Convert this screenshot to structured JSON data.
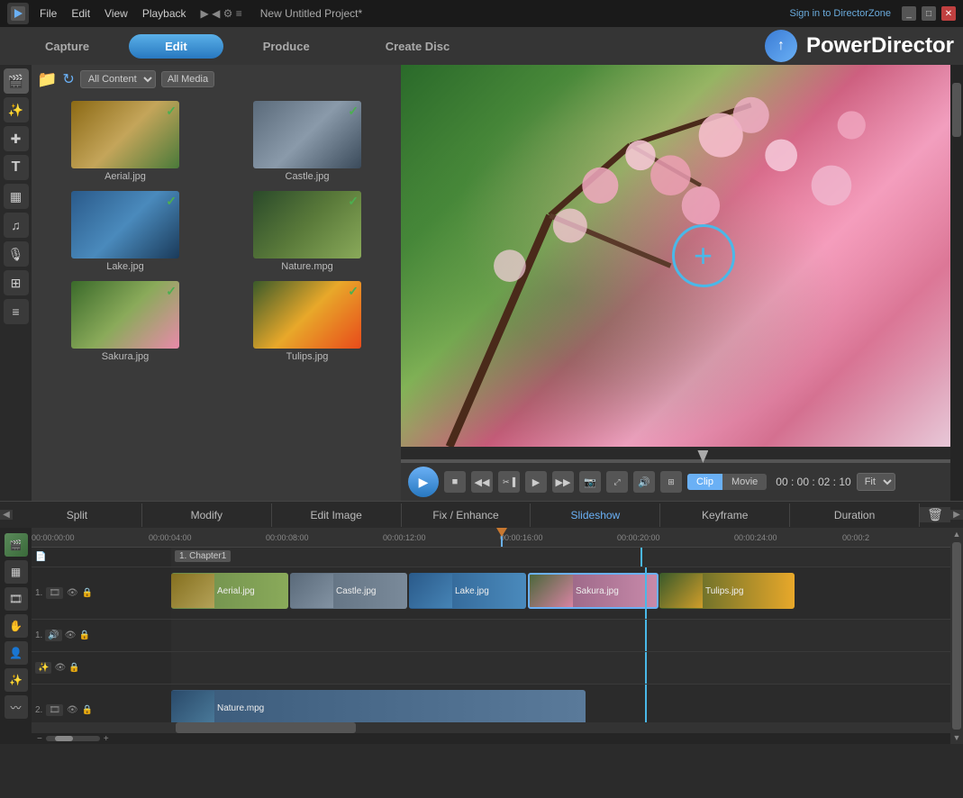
{
  "titlebar": {
    "menu": [
      "File",
      "Edit",
      "View",
      "Playback"
    ],
    "project_title": "New Untitled Project*",
    "signin": "Sign in to DirectorZone",
    "help": "?",
    "brand": "PowerDirector"
  },
  "topnav": {
    "capture": "Capture",
    "edit": "Edit",
    "produce": "Produce",
    "create_disc": "Create Disc"
  },
  "media_panel": {
    "filter": "All Content",
    "filter2": "All Media",
    "items": [
      {
        "name": "Aerial.jpg",
        "thumb_class": "thumb-aerial"
      },
      {
        "name": "Castle.jpg",
        "thumb_class": "thumb-castle"
      },
      {
        "name": "Lake.jpg",
        "thumb_class": "thumb-lake"
      },
      {
        "name": "Nature.mpg",
        "thumb_class": "thumb-nature"
      },
      {
        "name": "Sakura.jpg",
        "thumb_class": "thumb-sakura"
      },
      {
        "name": "Tulips.jpg",
        "thumb_class": "thumb-tulips"
      }
    ]
  },
  "preview": {
    "clip_label": "Clip",
    "movie_label": "Movie",
    "timecode": "00 : 00 : 02 : 10",
    "fit_label": "Fit"
  },
  "timeline_toolbar": {
    "split": "Split",
    "modify": "Modify",
    "edit_image": "Edit Image",
    "fix_enhance": "Fix / Enhance",
    "slideshow": "Slideshow",
    "keyframe": "Keyframe",
    "duration": "Duration"
  },
  "timeline": {
    "ruler_marks": [
      "00:00:00:00",
      "00:00:04:00",
      "00:00:08:00",
      "00:00:12:00",
      "00:00:16:00",
      "00:00:20:00",
      "00:00:24:00",
      "00:00:2"
    ],
    "chapter_label": "1. Chapter1",
    "track1_clips": [
      {
        "name": "Aerial.jpg"
      },
      {
        "name": "Castle.jpg"
      },
      {
        "name": "Lake.jpg"
      },
      {
        "name": "Sakura.jpg"
      },
      {
        "name": "Tulips.jpg"
      }
    ],
    "track2_clips": [
      {
        "name": "Nature.mpg"
      }
    ],
    "track1_label": "1.",
    "track2_label": "2."
  }
}
